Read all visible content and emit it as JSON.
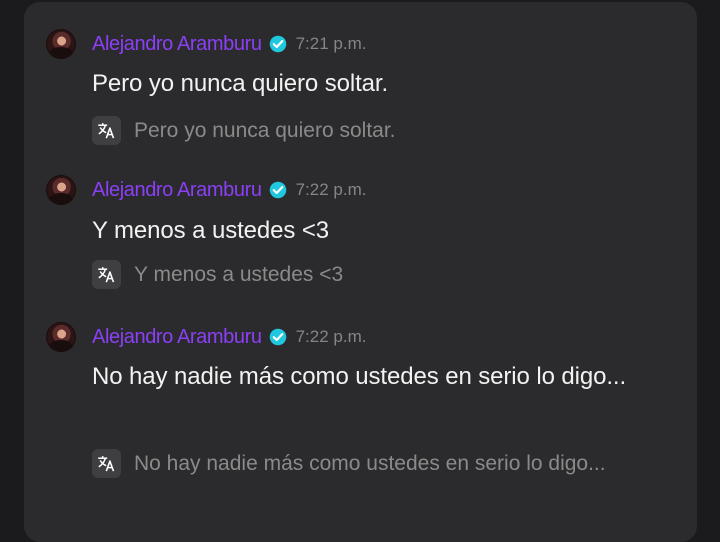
{
  "messages": [
    {
      "author": "Alejandro Aramburu",
      "timestamp": "7:21 p.m.",
      "text": "Pero yo nunca quiero soltar.",
      "translation": "Pero yo nunca quiero soltar.",
      "avatar_icon": "user-avatar",
      "verified_icon": "verified-badge-icon",
      "translate_icon": "translate-icon"
    },
    {
      "author": "Alejandro Aramburu",
      "timestamp": "7:22 p.m.",
      "text": "Y menos a ustedes <3",
      "translation": "Y menos a ustedes <3",
      "avatar_icon": "user-avatar",
      "verified_icon": "verified-badge-icon",
      "translate_icon": "translate-icon"
    },
    {
      "author": "Alejandro Aramburu",
      "timestamp": "7:22 p.m.",
      "text": "No hay nadie más como ustedes en serio lo digo...",
      "translation": "No hay nadie más como ustedes en serio lo digo...",
      "avatar_icon": "user-avatar",
      "verified_icon": "verified-badge-icon",
      "translate_icon": "translate-icon"
    }
  ],
  "colors": {
    "background": "#1b1b1d",
    "panel": "#2b2b2d",
    "author": "#8b3ff6",
    "verified": "#1fc7df",
    "timestamp": "#858585",
    "message_text": "#f2f2f2",
    "translation_text": "#8a8a8a",
    "translate_button": "#3f3f42"
  }
}
